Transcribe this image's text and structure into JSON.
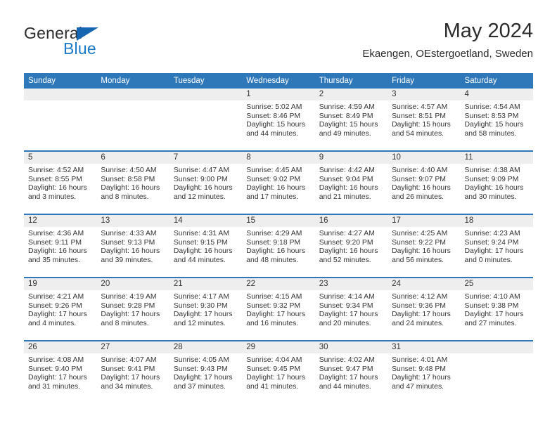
{
  "brand": {
    "name_part1": "General",
    "name_part2": "Blue"
  },
  "header": {
    "title": "May 2024",
    "subtitle": "Ekaengen, OEstergoetland, Sweden"
  },
  "colors": {
    "header_blue": "#2e77b8",
    "brand_blue": "#1a79c8",
    "day_band_gray": "#eeeeee",
    "text": "#333333"
  },
  "weekdays": [
    "Sunday",
    "Monday",
    "Tuesday",
    "Wednesday",
    "Thursday",
    "Friday",
    "Saturday"
  ],
  "weeks": [
    [
      {
        "day": "",
        "empty": true,
        "sunrise": "",
        "sunset": "",
        "daylight1": "",
        "daylight2": ""
      },
      {
        "day": "",
        "empty": true,
        "sunrise": "",
        "sunset": "",
        "daylight1": "",
        "daylight2": ""
      },
      {
        "day": "",
        "empty": true,
        "sunrise": "",
        "sunset": "",
        "daylight1": "",
        "daylight2": ""
      },
      {
        "day": "1",
        "sunrise": "Sunrise: 5:02 AM",
        "sunset": "Sunset: 8:46 PM",
        "daylight1": "Daylight: 15 hours",
        "daylight2": "and 44 minutes."
      },
      {
        "day": "2",
        "sunrise": "Sunrise: 4:59 AM",
        "sunset": "Sunset: 8:49 PM",
        "daylight1": "Daylight: 15 hours",
        "daylight2": "and 49 minutes."
      },
      {
        "day": "3",
        "sunrise": "Sunrise: 4:57 AM",
        "sunset": "Sunset: 8:51 PM",
        "daylight1": "Daylight: 15 hours",
        "daylight2": "and 54 minutes."
      },
      {
        "day": "4",
        "sunrise": "Sunrise: 4:54 AM",
        "sunset": "Sunset: 8:53 PM",
        "daylight1": "Daylight: 15 hours",
        "daylight2": "and 58 minutes."
      }
    ],
    [
      {
        "day": "5",
        "sunrise": "Sunrise: 4:52 AM",
        "sunset": "Sunset: 8:55 PM",
        "daylight1": "Daylight: 16 hours",
        "daylight2": "and 3 minutes."
      },
      {
        "day": "6",
        "sunrise": "Sunrise: 4:50 AM",
        "sunset": "Sunset: 8:58 PM",
        "daylight1": "Daylight: 16 hours",
        "daylight2": "and 8 minutes."
      },
      {
        "day": "7",
        "sunrise": "Sunrise: 4:47 AM",
        "sunset": "Sunset: 9:00 PM",
        "daylight1": "Daylight: 16 hours",
        "daylight2": "and 12 minutes."
      },
      {
        "day": "8",
        "sunrise": "Sunrise: 4:45 AM",
        "sunset": "Sunset: 9:02 PM",
        "daylight1": "Daylight: 16 hours",
        "daylight2": "and 17 minutes."
      },
      {
        "day": "9",
        "sunrise": "Sunrise: 4:42 AM",
        "sunset": "Sunset: 9:04 PM",
        "daylight1": "Daylight: 16 hours",
        "daylight2": "and 21 minutes."
      },
      {
        "day": "10",
        "sunrise": "Sunrise: 4:40 AM",
        "sunset": "Sunset: 9:07 PM",
        "daylight1": "Daylight: 16 hours",
        "daylight2": "and 26 minutes."
      },
      {
        "day": "11",
        "sunrise": "Sunrise: 4:38 AM",
        "sunset": "Sunset: 9:09 PM",
        "daylight1": "Daylight: 16 hours",
        "daylight2": "and 30 minutes."
      }
    ],
    [
      {
        "day": "12",
        "sunrise": "Sunrise: 4:36 AM",
        "sunset": "Sunset: 9:11 PM",
        "daylight1": "Daylight: 16 hours",
        "daylight2": "and 35 minutes."
      },
      {
        "day": "13",
        "sunrise": "Sunrise: 4:33 AM",
        "sunset": "Sunset: 9:13 PM",
        "daylight1": "Daylight: 16 hours",
        "daylight2": "and 39 minutes."
      },
      {
        "day": "14",
        "sunrise": "Sunrise: 4:31 AM",
        "sunset": "Sunset: 9:15 PM",
        "daylight1": "Daylight: 16 hours",
        "daylight2": "and 44 minutes."
      },
      {
        "day": "15",
        "sunrise": "Sunrise: 4:29 AM",
        "sunset": "Sunset: 9:18 PM",
        "daylight1": "Daylight: 16 hours",
        "daylight2": "and 48 minutes."
      },
      {
        "day": "16",
        "sunrise": "Sunrise: 4:27 AM",
        "sunset": "Sunset: 9:20 PM",
        "daylight1": "Daylight: 16 hours",
        "daylight2": "and 52 minutes."
      },
      {
        "day": "17",
        "sunrise": "Sunrise: 4:25 AM",
        "sunset": "Sunset: 9:22 PM",
        "daylight1": "Daylight: 16 hours",
        "daylight2": "and 56 minutes."
      },
      {
        "day": "18",
        "sunrise": "Sunrise: 4:23 AM",
        "sunset": "Sunset: 9:24 PM",
        "daylight1": "Daylight: 17 hours",
        "daylight2": "and 0 minutes."
      }
    ],
    [
      {
        "day": "19",
        "sunrise": "Sunrise: 4:21 AM",
        "sunset": "Sunset: 9:26 PM",
        "daylight1": "Daylight: 17 hours",
        "daylight2": "and 4 minutes."
      },
      {
        "day": "20",
        "sunrise": "Sunrise: 4:19 AM",
        "sunset": "Sunset: 9:28 PM",
        "daylight1": "Daylight: 17 hours",
        "daylight2": "and 8 minutes."
      },
      {
        "day": "21",
        "sunrise": "Sunrise: 4:17 AM",
        "sunset": "Sunset: 9:30 PM",
        "daylight1": "Daylight: 17 hours",
        "daylight2": "and 12 minutes."
      },
      {
        "day": "22",
        "sunrise": "Sunrise: 4:15 AM",
        "sunset": "Sunset: 9:32 PM",
        "daylight1": "Daylight: 17 hours",
        "daylight2": "and 16 minutes."
      },
      {
        "day": "23",
        "sunrise": "Sunrise: 4:14 AM",
        "sunset": "Sunset: 9:34 PM",
        "daylight1": "Daylight: 17 hours",
        "daylight2": "and 20 minutes."
      },
      {
        "day": "24",
        "sunrise": "Sunrise: 4:12 AM",
        "sunset": "Sunset: 9:36 PM",
        "daylight1": "Daylight: 17 hours",
        "daylight2": "and 24 minutes."
      },
      {
        "day": "25",
        "sunrise": "Sunrise: 4:10 AM",
        "sunset": "Sunset: 9:38 PM",
        "daylight1": "Daylight: 17 hours",
        "daylight2": "and 27 minutes."
      }
    ],
    [
      {
        "day": "26",
        "sunrise": "Sunrise: 4:08 AM",
        "sunset": "Sunset: 9:40 PM",
        "daylight1": "Daylight: 17 hours",
        "daylight2": "and 31 minutes."
      },
      {
        "day": "27",
        "sunrise": "Sunrise: 4:07 AM",
        "sunset": "Sunset: 9:41 PM",
        "daylight1": "Daylight: 17 hours",
        "daylight2": "and 34 minutes."
      },
      {
        "day": "28",
        "sunrise": "Sunrise: 4:05 AM",
        "sunset": "Sunset: 9:43 PM",
        "daylight1": "Daylight: 17 hours",
        "daylight2": "and 37 minutes."
      },
      {
        "day": "29",
        "sunrise": "Sunrise: 4:04 AM",
        "sunset": "Sunset: 9:45 PM",
        "daylight1": "Daylight: 17 hours",
        "daylight2": "and 41 minutes."
      },
      {
        "day": "30",
        "sunrise": "Sunrise: 4:02 AM",
        "sunset": "Sunset: 9:47 PM",
        "daylight1": "Daylight: 17 hours",
        "daylight2": "and 44 minutes."
      },
      {
        "day": "31",
        "sunrise": "Sunrise: 4:01 AM",
        "sunset": "Sunset: 9:48 PM",
        "daylight1": "Daylight: 17 hours",
        "daylight2": "and 47 minutes."
      },
      {
        "day": "",
        "empty": true,
        "sunrise": "",
        "sunset": "",
        "daylight1": "",
        "daylight2": ""
      }
    ]
  ]
}
